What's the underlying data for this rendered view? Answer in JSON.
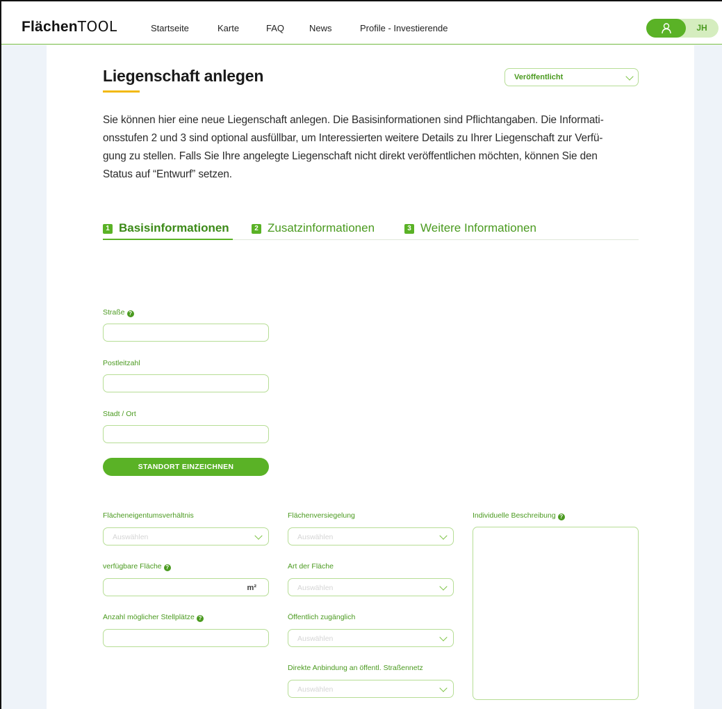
{
  "header": {
    "logo_bold": "Flächen",
    "logo_light": "TOOL",
    "nav": [
      {
        "label": "Startseite"
      },
      {
        "label": "Karte"
      },
      {
        "label": "FAQ"
      },
      {
        "label": "News"
      },
      {
        "label": "Profile - Investierende"
      }
    ],
    "user_initials": "JH",
    "user_icon": "user-icon"
  },
  "page": {
    "title": "Liegenschaft anlegen",
    "status_select": {
      "value": "Veröffentlicht"
    },
    "intro_lines": [
      "Sie können hier eine neue Liegenschaft anlegen. Die Basisinformationen sind Pflichtangaben. Die Informati-",
      "onsstufen 2 und 3 sind optional ausfüllbar, um Interessierten weitere Details zu Ihrer Liegenschaft zur Verfü-",
      "gung zu stellen. Falls Sie Ihre angelegte Liegenschaft nicht direkt veröffentlichen möchten, können Sie den",
      "Status auf “Entwurf” setzen."
    ]
  },
  "tabs": [
    {
      "num": "1",
      "label": "Basisinformationen",
      "active": true
    },
    {
      "num": "2",
      "label": "Zusatzinformationen",
      "active": false
    },
    {
      "num": "3",
      "label": "Weitere Informationen",
      "active": false
    }
  ],
  "form": {
    "strasse": {
      "label": "Straße",
      "value": ""
    },
    "plz": {
      "label": "Postleitzahl",
      "value": ""
    },
    "ort": {
      "label": "Stadt / Ort",
      "value": ""
    },
    "standort_button": "STANDORT EINZEICHNEN",
    "eigentum": {
      "label": "Flächeneigentumsverhältnis",
      "placeholder": "Auswählen"
    },
    "flaeche": {
      "label": "verfügbare Fläche",
      "unit": "m²",
      "value": ""
    },
    "stellplaetze": {
      "label": "Anzahl möglicher Stellplätze",
      "value": ""
    },
    "versiegelung": {
      "label": "Flächenversiegelung",
      "placeholder": "Auswählen"
    },
    "art": {
      "label": "Art der Fläche",
      "placeholder": "Auswählen"
    },
    "oeffentlich": {
      "label": "Öffentlich zugänglich",
      "placeholder": "Auswählen"
    },
    "anbindung": {
      "label": "Direkte Anbindung an öffentl. Straßennetz",
      "placeholder": "Auswählen"
    },
    "beschreibung": {
      "label": "Individuelle Beschreibung",
      "value": ""
    },
    "help_glyph": "?"
  },
  "colors": {
    "accent_green": "#5ab226",
    "label_green": "#4a9a1f",
    "border_green": "#b6dd95",
    "title_underline": "#f2b90f"
  }
}
